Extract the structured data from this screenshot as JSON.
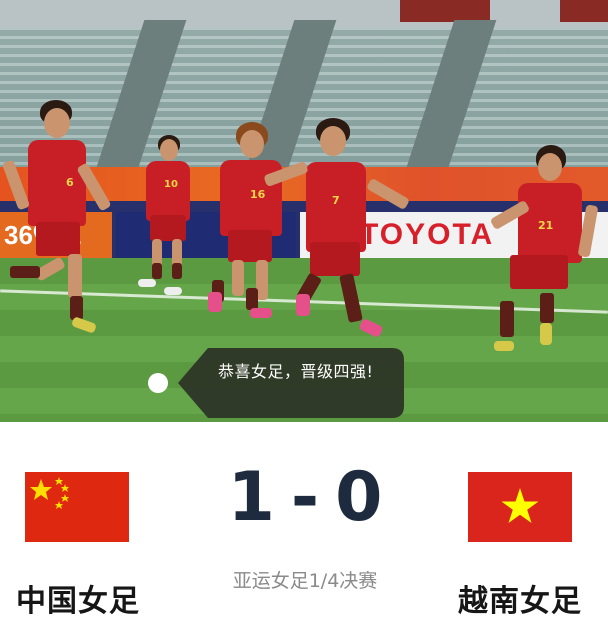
{
  "toast": {
    "message": "恭喜女足，晋级四强!"
  },
  "match": {
    "home_team": "中国女足",
    "away_team": "越南女足",
    "home_score": "1",
    "away_score": "0",
    "separator": "-",
    "stage": "亚运女足1/4决赛"
  },
  "photo": {
    "ad_text": "TOYOTA",
    "players": [
      {
        "number": "6"
      },
      {
        "number": "10"
      },
      {
        "number": "16"
      },
      {
        "number": "7"
      },
      {
        "number": "21"
      }
    ]
  },
  "colors": {
    "china_red": "#de2910",
    "china_star": "#ffde00",
    "vietnam_red": "#da251d",
    "vietnam_star": "#ffff00",
    "toast_bg": "#2c3526",
    "score_text": "#1e2b3f",
    "stage_text": "#8a8a8a"
  }
}
